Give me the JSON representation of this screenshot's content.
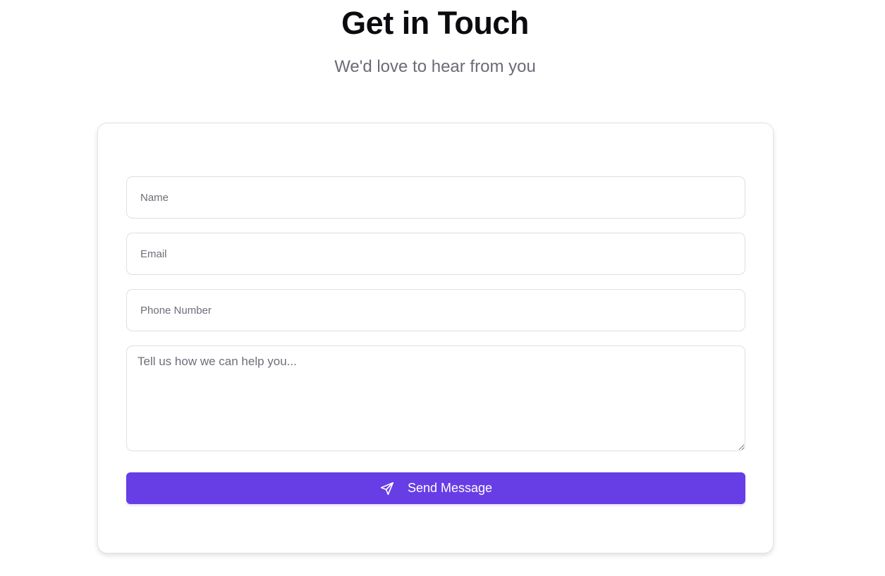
{
  "header": {
    "title": "Get in Touch",
    "subtitle": "We'd love to hear from you"
  },
  "form": {
    "name_placeholder": "Name",
    "email_placeholder": "Email",
    "phone_placeholder": "Phone Number",
    "message_placeholder": "Tell us how we can help you...",
    "submit_label": "Send Message",
    "submit_icon": "send-icon"
  },
  "colors": {
    "accent": "#673de6",
    "title": "#0b0b0f",
    "subtitle": "#6b6b78"
  }
}
